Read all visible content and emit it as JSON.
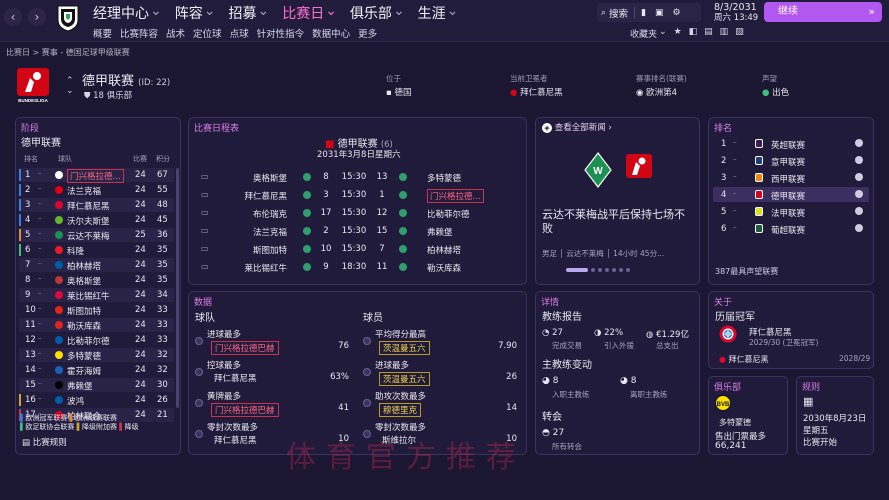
{
  "top": {
    "menu": [
      "经理中心",
      "阵容",
      "招募",
      "比赛日",
      "俱乐部",
      "生涯"
    ],
    "submenu": [
      "概要",
      "比赛阵容",
      "战术",
      "定位球",
      "点球",
      "针对性指令",
      "数据中心",
      "更多"
    ],
    "search_label": "搜索",
    "date_line1": "8/3/2031",
    "date_line2": "周六 13:49",
    "continue": "继续",
    "right_tools": [
      "收藏夹"
    ]
  },
  "breadcrumb": "比赛日 > 赛事 - 德国足球甲级联赛",
  "header": {
    "title": "德甲联赛",
    "id": "(ID: 22)",
    "clubs": "18 俱乐部",
    "logo_text": "BUNDESLIGA",
    "f1_label": "位于",
    "f1_value": "德国",
    "f2_label": "当前卫冕者",
    "f2_value": "拜仁慕尼黑",
    "f3_label": "赛事排名(联赛)",
    "f3_value": "欧洲第4",
    "f4_label": "声望",
    "f4_value": "出色"
  },
  "stage": {
    "title": "阶段",
    "competition": "德甲联赛",
    "col_pos": "排名",
    "col_team": "球队",
    "col_played": "比赛",
    "col_pts": "积分",
    "rows": [
      {
        "pos": "1",
        "team": "门兴格拉德...",
        "p": "24",
        "pts": "67",
        "hl": true
      },
      {
        "pos": "2",
        "team": "法兰克福",
        "p": "24",
        "pts": "55"
      },
      {
        "pos": "3",
        "team": "拜仁慕尼黑",
        "p": "24",
        "pts": "48"
      },
      {
        "pos": "4",
        "team": "沃尔夫斯堡",
        "p": "24",
        "pts": "45"
      },
      {
        "pos": "5",
        "team": "云达不莱梅",
        "p": "25",
        "pts": "36"
      },
      {
        "pos": "6",
        "team": "科隆",
        "p": "24",
        "pts": "35"
      },
      {
        "pos": "7",
        "team": "柏林赫塔",
        "p": "24",
        "pts": "35"
      },
      {
        "pos": "8",
        "team": "奥格斯堡",
        "p": "24",
        "pts": "35"
      },
      {
        "pos": "9",
        "team": "莱比锡红牛",
        "p": "24",
        "pts": "34"
      },
      {
        "pos": "10",
        "team": "斯图加特",
        "p": "24",
        "pts": "33"
      },
      {
        "pos": "11",
        "team": "勒沃库森",
        "p": "24",
        "pts": "33"
      },
      {
        "pos": "12",
        "team": "比勒菲尔德",
        "p": "24",
        "pts": "33"
      },
      {
        "pos": "13",
        "team": "多特蒙德",
        "p": "24",
        "pts": "32"
      },
      {
        "pos": "14",
        "team": "霍芬海姆",
        "p": "24",
        "pts": "32"
      },
      {
        "pos": "15",
        "team": "弗赖堡",
        "p": "24",
        "pts": "30"
      },
      {
        "pos": "16",
        "team": "波鸿",
        "p": "24",
        "pts": "26"
      },
      {
        "pos": "17",
        "team": "柏林联合",
        "p": "24",
        "pts": "21"
      }
    ],
    "legend1": "欧洲冠军联赛",
    "legend2": "欧洲联赛联赛",
    "legend3": "欧足联协会联赛",
    "legend4": "降级附加赛",
    "legend5": "降级",
    "rules": "比赛规则"
  },
  "fixtures": {
    "title": "比赛日程表",
    "competition": "德甲联赛",
    "count": "(6)",
    "date": "2031年3月8日星期六",
    "rows": [
      {
        "home": "奥格斯堡",
        "hs": "8",
        "time": "15:30",
        "as": "13",
        "away": "多特蒙德"
      },
      {
        "home": "拜仁慕尼黑",
        "hs": "3",
        "time": "15:30",
        "as": "1",
        "away": "门兴格拉德...",
        "away_hl": true
      },
      {
        "home": "布伦瑞克",
        "hs": "17",
        "time": "15:30",
        "as": "12",
        "away": "比勒菲尔德"
      },
      {
        "home": "法兰克福",
        "hs": "2",
        "time": "15:30",
        "as": "15",
        "away": "弗赖堡"
      },
      {
        "home": "斯图加特",
        "hs": "10",
        "time": "15:30",
        "as": "7",
        "away": "柏林赫塔"
      },
      {
        "home": "莱比锡红牛",
        "hs": "9",
        "time": "18:30",
        "as": "11",
        "away": "勒沃库森"
      }
    ]
  },
  "news": {
    "link": "查看全部新闻",
    "headline": "云达不莱梅战平后保持七场不败",
    "tag": "男足",
    "source": "云达不莱梅",
    "time": "14小时 45分..."
  },
  "ranking": {
    "title": "排名",
    "rows": [
      {
        "pos": "1",
        "league": "英超联赛"
      },
      {
        "pos": "2",
        "league": "意甲联赛"
      },
      {
        "pos": "3",
        "league": "西甲联赛"
      },
      {
        "pos": "4",
        "league": "德甲联赛",
        "hl": true
      },
      {
        "pos": "5",
        "league": "法甲联赛"
      },
      {
        "pos": "6",
        "league": "葡超联赛"
      }
    ],
    "footer": "387最具声望联赛"
  },
  "stats": {
    "title": "数据",
    "team_header": "球队",
    "player_header": "球员",
    "team_rows": [
      {
        "label": "进球最多",
        "name": "门兴格拉德巴赫",
        "val": "76",
        "color": "red"
      },
      {
        "label": "控球最多",
        "name": "拜仁慕尼黑",
        "val": "63%",
        "color": "plain"
      },
      {
        "label": "黄牌最多",
        "name": "门兴格拉德巴赫",
        "val": "41",
        "color": "red"
      },
      {
        "label": "零封次数最多",
        "name": "拜仁慕尼黑",
        "val": "10",
        "color": "plain"
      }
    ],
    "player_rows": [
      {
        "label": "平均得分最高",
        "name": "茨温曼五六",
        "val": "7.90",
        "color": "yel"
      },
      {
        "label": "进球最多",
        "name": "茨温曼五六",
        "val": "26",
        "color": "yel"
      },
      {
        "label": "助攻次数最多",
        "name": "穆德里克",
        "val": "14",
        "color": "yel"
      },
      {
        "label": "零封次数最多",
        "name": "斯维拉尔",
        "val": "10",
        "color": "plain"
      }
    ]
  },
  "details": {
    "title": "详情",
    "coach_report": "教练报告",
    "done": "27",
    "done_label": "完成交易",
    "outgoing_pct": "22%",
    "outgoing_label": "引入外援",
    "spend": "€1.29亿",
    "spend_label": "总支出",
    "coach_change": "主教练变动",
    "in_count": "8",
    "in_label": "入职主教练",
    "out_count": "8",
    "out_label": "离职主教练",
    "transfers": "转会",
    "transfers_count": "27",
    "transfers_label": "所有转会"
  },
  "about": {
    "title": "关于",
    "champions": "历届冠军",
    "c1_team": "拜仁慕尼黑",
    "c1_note": "2029/30 (卫冕冠军)",
    "c2_team": "拜仁慕尼黑",
    "c2_year": "2028/29"
  },
  "club": {
    "title": "俱乐部",
    "team": "多特蒙德",
    "label": "售出门票最多",
    "value": "66,241"
  },
  "rules": {
    "title": "规则",
    "date": "2030年8月23日",
    "day": "星期五",
    "label": "比赛开始"
  },
  "watermark": "体育官方推荐",
  "colors": {
    "accent": "#b257f0",
    "header_pink": "#d87ee6",
    "highlight_red": "#ff5e7a",
    "gold": "#f0d44a",
    "bg": "#1b1631"
  }
}
